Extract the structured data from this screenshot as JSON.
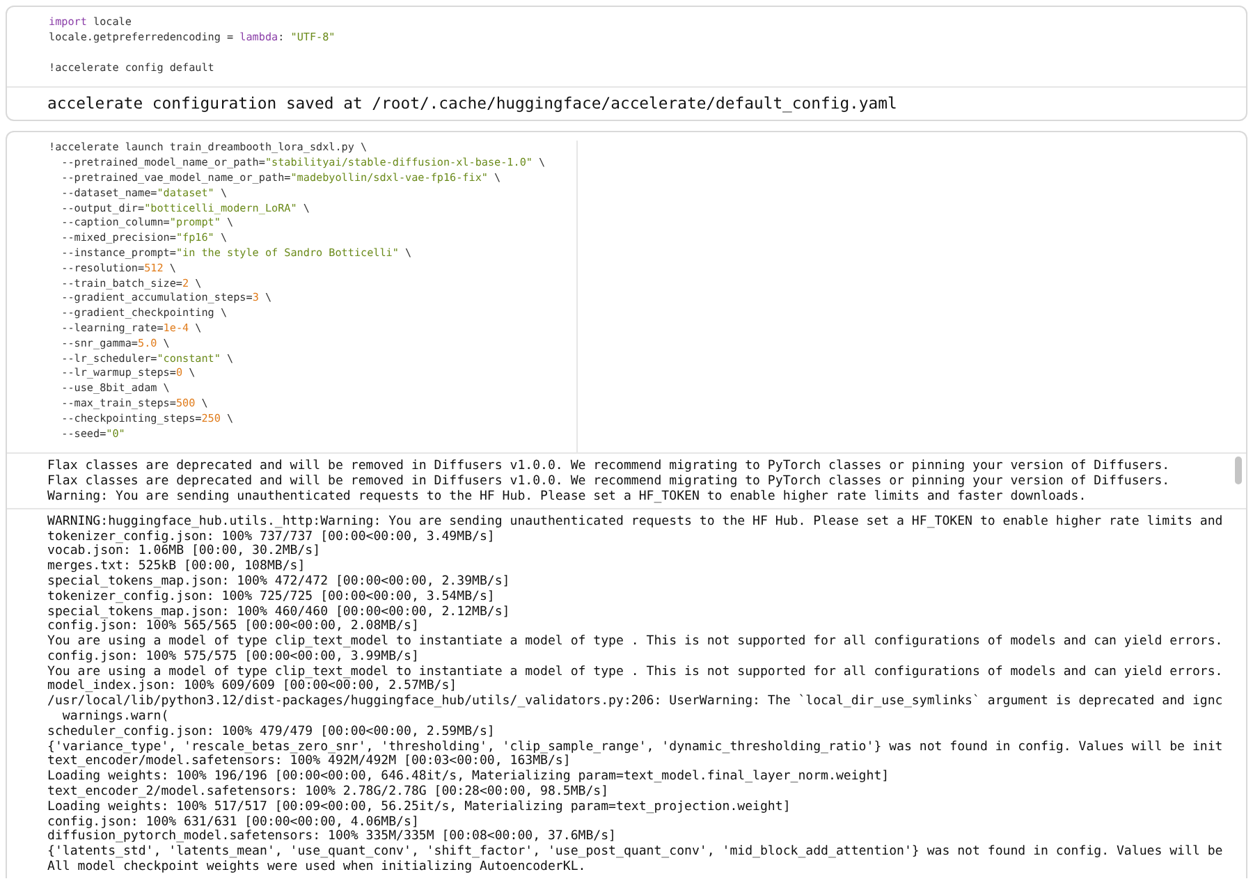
{
  "cells": [
    {
      "code": [
        {
          "tokens": [
            {
              "text": "import",
              "kind": "keyword"
            },
            {
              "text": " locale",
              "kind": "plain"
            }
          ]
        },
        {
          "tokens": [
            {
              "text": "locale.getpreferredencoding = ",
              "kind": "plain"
            },
            {
              "text": "lambda",
              "kind": "keyword"
            },
            {
              "text": ": ",
              "kind": "plain"
            },
            {
              "text": "\"UTF-8\"",
              "kind": "string"
            }
          ]
        },
        {
          "gap_before": true,
          "tokens": [
            {
              "text": "!accelerate config default",
              "kind": "plain"
            }
          ]
        }
      ],
      "outputs": [
        {
          "kind": "result",
          "lines": [
            "accelerate configuration saved at /root/.cache/huggingface/accelerate/default_config.yaml"
          ]
        }
      ]
    },
    {
      "code": [
        {
          "tokens": [
            {
              "text": "!accelerate launch train_dreambooth_lora_sdxl.py \\",
              "kind": "plain"
            }
          ]
        },
        {
          "tokens": [
            {
              "text": "  --pretrained_model_name_or_path=",
              "kind": "plain"
            },
            {
              "text": "\"stabilityai/stable-diffusion-xl-base-1.0\"",
              "kind": "string"
            },
            {
              "text": " \\",
              "kind": "plain"
            }
          ]
        },
        {
          "tokens": [
            {
              "text": "  --pretrained_vae_model_name_or_path=",
              "kind": "plain"
            },
            {
              "text": "\"madebyollin/sdxl-vae-fp16-fix\"",
              "kind": "string"
            },
            {
              "text": " \\",
              "kind": "plain"
            }
          ]
        },
        {
          "tokens": [
            {
              "text": "  --dataset_name=",
              "kind": "plain"
            },
            {
              "text": "\"dataset\"",
              "kind": "string"
            },
            {
              "text": " \\",
              "kind": "plain"
            }
          ]
        },
        {
          "tokens": [
            {
              "text": "  --output_dir=",
              "kind": "plain"
            },
            {
              "text": "\"botticelli_modern_LoRA\"",
              "kind": "string"
            },
            {
              "text": " \\",
              "kind": "plain"
            }
          ]
        },
        {
          "tokens": [
            {
              "text": "  --caption_column=",
              "kind": "plain"
            },
            {
              "text": "\"prompt\"",
              "kind": "string"
            },
            {
              "text": " \\",
              "kind": "plain"
            }
          ]
        },
        {
          "tokens": [
            {
              "text": "  --mixed_precision=",
              "kind": "plain"
            },
            {
              "text": "\"fp16\"",
              "kind": "string"
            },
            {
              "text": " \\",
              "kind": "plain"
            }
          ]
        },
        {
          "tokens": [
            {
              "text": "  --instance_prompt=",
              "kind": "plain"
            },
            {
              "text": "\"in the style of Sandro Botticelli\"",
              "kind": "string"
            },
            {
              "text": " \\",
              "kind": "plain"
            }
          ]
        },
        {
          "tokens": [
            {
              "text": "  --resolution=",
              "kind": "plain"
            },
            {
              "text": "512",
              "kind": "number"
            },
            {
              "text": " \\",
              "kind": "plain"
            }
          ]
        },
        {
          "tokens": [
            {
              "text": "  --train_batch_size=",
              "kind": "plain"
            },
            {
              "text": "2",
              "kind": "number"
            },
            {
              "text": " \\",
              "kind": "plain"
            }
          ]
        },
        {
          "tokens": [
            {
              "text": "  --gradient_accumulation_steps=",
              "kind": "plain"
            },
            {
              "text": "3",
              "kind": "number"
            },
            {
              "text": " \\",
              "kind": "plain"
            }
          ]
        },
        {
          "tokens": [
            {
              "text": "  --gradient_checkpointing \\",
              "kind": "plain"
            }
          ]
        },
        {
          "tokens": [
            {
              "text": "  --learning_rate=",
              "kind": "plain"
            },
            {
              "text": "1e-4",
              "kind": "number"
            },
            {
              "text": " \\",
              "kind": "plain"
            }
          ]
        },
        {
          "tokens": [
            {
              "text": "  --snr_gamma=",
              "kind": "plain"
            },
            {
              "text": "5.0",
              "kind": "number"
            },
            {
              "text": " \\",
              "kind": "plain"
            }
          ]
        },
        {
          "tokens": [
            {
              "text": "  --lr_scheduler=",
              "kind": "plain"
            },
            {
              "text": "\"constant\"",
              "kind": "string"
            },
            {
              "text": " \\",
              "kind": "plain"
            }
          ]
        },
        {
          "tokens": [
            {
              "text": "  --lr_warmup_steps=",
              "kind": "plain"
            },
            {
              "text": "0",
              "kind": "number"
            },
            {
              "text": " \\",
              "kind": "plain"
            }
          ]
        },
        {
          "tokens": [
            {
              "text": "  --use_8bit_adam \\",
              "kind": "plain"
            }
          ]
        },
        {
          "tokens": [
            {
              "text": "  --max_train_steps=",
              "kind": "plain"
            },
            {
              "text": "500",
              "kind": "number"
            },
            {
              "text": " \\",
              "kind": "plain"
            }
          ]
        },
        {
          "tokens": [
            {
              "text": "  --checkpointing_steps=",
              "kind": "plain"
            },
            {
              "text": "250",
              "kind": "number"
            },
            {
              "text": " \\",
              "kind": "plain"
            }
          ]
        },
        {
          "tokens": [
            {
              "text": "  --seed=",
              "kind": "plain"
            },
            {
              "text": "\"0\"",
              "kind": "string"
            }
          ]
        }
      ],
      "outputs": [
        {
          "kind": "log",
          "lines": [
            "Flax classes are deprecated and will be removed in Diffusers v1.0.0. We recommend migrating to PyTorch classes or pinning your version of Diffusers.",
            "Flax classes are deprecated and will be removed in Diffusers v1.0.0. We recommend migrating to PyTorch classes or pinning your version of Diffusers.",
            "Warning: You are sending unauthenticated requests to the HF Hub. Please set a HF_TOKEN to enable higher rate limits and faster downloads."
          ]
        },
        {
          "kind": "log",
          "lines": [
            "WARNING:huggingface_hub.utils._http:Warning: You are sending unauthenticated requests to the HF Hub. Please set a HF_TOKEN to enable higher rate limits and",
            "tokenizer_config.json: 100% 737/737 [00:00<00:00, 3.49MB/s]",
            "vocab.json: 1.06MB [00:00, 30.2MB/s]",
            "merges.txt: 525kB [00:00, 108MB/s]",
            "special_tokens_map.json: 100% 472/472 [00:00<00:00, 2.39MB/s]",
            "tokenizer_config.json: 100% 725/725 [00:00<00:00, 3.54MB/s]",
            "special_tokens_map.json: 100% 460/460 [00:00<00:00, 2.12MB/s]",
            "config.json: 100% 565/565 [00:00<00:00, 2.08MB/s]",
            "You are using a model of type clip_text_model to instantiate a model of type . This is not supported for all configurations of models and can yield errors.",
            "config.json: 100% 575/575 [00:00<00:00, 3.99MB/s]",
            "You are using a model of type clip_text_model to instantiate a model of type . This is not supported for all configurations of models and can yield errors.",
            "model_index.json: 100% 609/609 [00:00<00:00, 2.57MB/s]",
            "/usr/local/lib/python3.12/dist-packages/huggingface_hub/utils/_validators.py:206: UserWarning: The `local_dir_use_symlinks` argument is deprecated and ignc",
            "  warnings.warn(",
            "scheduler_config.json: 100% 479/479 [00:00<00:00, 2.59MB/s]",
            "{'variance_type', 'rescale_betas_zero_snr', 'thresholding', 'clip_sample_range', 'dynamic_thresholding_ratio'} was not found in config. Values will be init",
            "text_encoder/model.safetensors: 100% 492M/492M [00:03<00:00, 163MB/s]",
            "Loading weights: 100% 196/196 [00:00<00:00, 646.48it/s, Materializing param=text_model.final_layer_norm.weight]",
            "text_encoder_2/model.safetensors: 100% 2.78G/2.78G [00:28<00:00, 98.5MB/s]",
            "Loading weights: 100% 517/517 [00:09<00:00, 56.25it/s, Materializing param=text_projection.weight]",
            "config.json: 100% 631/631 [00:00<00:00, 4.06MB/s]",
            "diffusion_pytorch_model.safetensors: 100% 335M/335M [00:08<00:00, 37.6MB/s]",
            "{'latents_std', 'latents_mean', 'use_quant_conv', 'shift_factor', 'use_post_quant_conv', 'mid_block_add_attention'} was not found in config. Values will be",
            "All model checkpoint weights were used when initializing AutoencoderKL."
          ]
        }
      ]
    }
  ]
}
